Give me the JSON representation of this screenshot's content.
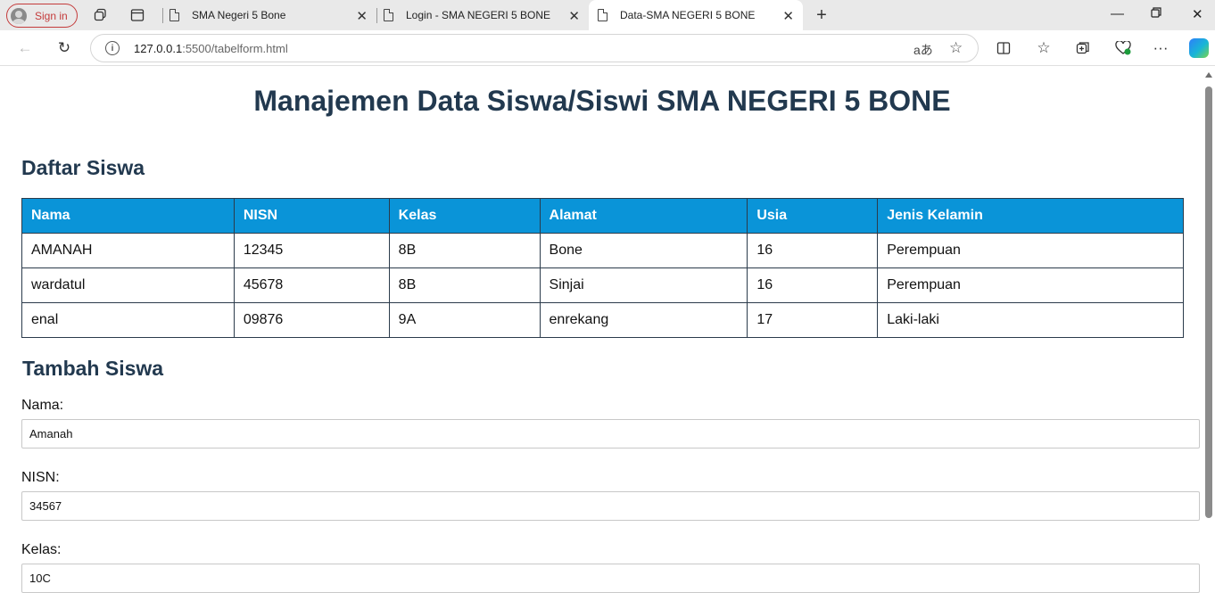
{
  "browser": {
    "signin_label": "Sign in",
    "tabs": [
      {
        "title": "SMA Negeri 5 Bone"
      },
      {
        "title": "Login - SMA NEGERI 5 BONE"
      },
      {
        "title": "Data-SMA NEGERI 5 BONE"
      }
    ],
    "url_host": "127.0.0.1",
    "url_path": ":5500/tabelform.html"
  },
  "page": {
    "title": "Manajemen Data Siswa/Siswi SMA NEGERI 5 BONE",
    "list_heading": "Daftar Siswa",
    "add_heading": "Tambah Siswa"
  },
  "table": {
    "headers": [
      "Nama",
      "NISN",
      "Kelas",
      "Alamat",
      "Usia",
      "Jenis Kelamin"
    ],
    "rows": [
      [
        "AMANAH",
        "12345",
        "8B",
        "Bone",
        "16",
        "Perempuan"
      ],
      [
        "wardatul",
        "45678",
        "8B",
        "Sinjai",
        "16",
        "Perempuan"
      ],
      [
        "enal",
        "09876",
        "9A",
        "enrekang",
        "17",
        "Laki-laki"
      ]
    ]
  },
  "form": {
    "nama_label": "Nama:",
    "nama_value": "Amanah",
    "nisn_label": "NISN:",
    "nisn_value": "34567",
    "kelas_label": "Kelas:",
    "kelas_value": "10C"
  },
  "colors": {
    "header_bg": "#0a94d8",
    "heading_text": "#22394f",
    "signin_accent": "#c43b3b"
  }
}
